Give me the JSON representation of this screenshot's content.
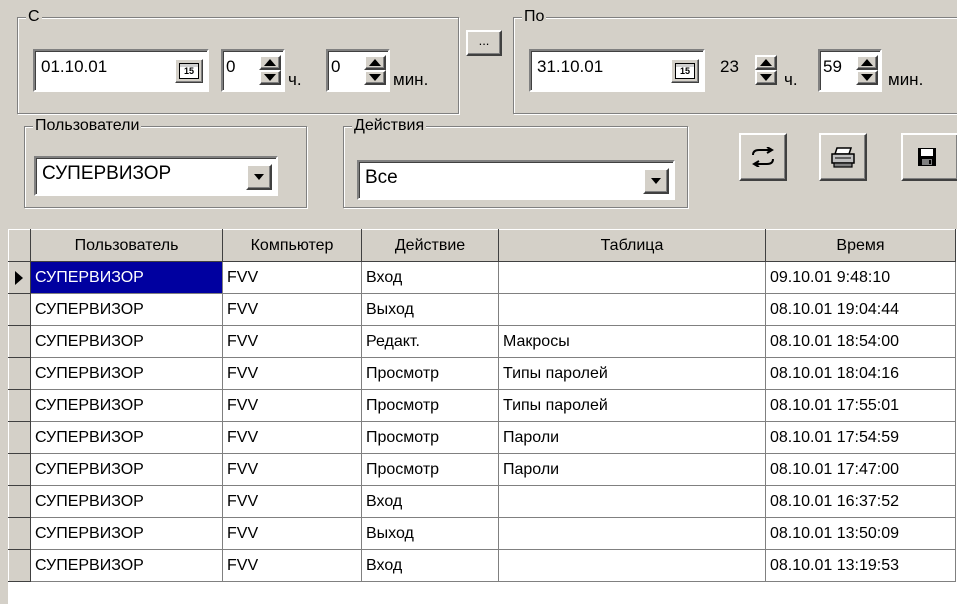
{
  "from": {
    "legend": "С",
    "date": "01.10.01",
    "calendar_icon_text": "15",
    "hours": "0",
    "hours_unit": "ч.",
    "minutes": "0",
    "minutes_unit": "мин."
  },
  "ellipsis_button_label": "...",
  "to": {
    "legend": "По",
    "date": "31.10.01",
    "calendar_icon_text": "15",
    "hours": "23",
    "hours_unit": "ч.",
    "minutes": "59",
    "minutes_unit": "мин."
  },
  "users": {
    "legend": "Пользователи",
    "selected": "СУПЕРВИЗОР"
  },
  "actions": {
    "legend": "Действия",
    "selected": "Все"
  },
  "toolbar_icons": [
    "refresh-icon",
    "printer-icon",
    "floppy-disk-icon"
  ],
  "table": {
    "columns": [
      "Пользователь",
      "Компьютер",
      "Действие",
      "Таблица",
      "Время"
    ],
    "rows": [
      [
        "СУПЕРВИЗОР",
        "FVV",
        "Вход",
        "",
        "09.10.01 9:48:10"
      ],
      [
        "СУПЕРВИЗОР",
        "FVV",
        "Выход",
        "",
        "08.10.01 19:04:44"
      ],
      [
        "СУПЕРВИЗОР",
        "FVV",
        "Редакт.",
        "Макросы",
        "08.10.01 18:54:00"
      ],
      [
        "СУПЕРВИЗОР",
        "FVV",
        "Просмотр",
        "Типы паролей",
        "08.10.01 18:04:16"
      ],
      [
        "СУПЕРВИЗОР",
        "FVV",
        "Просмотр",
        "Типы паролей",
        "08.10.01 17:55:01"
      ],
      [
        "СУПЕРВИЗОР",
        "FVV",
        "Просмотр",
        "Пароли",
        "08.10.01 17:54:59"
      ],
      [
        "СУПЕРВИЗОР",
        "FVV",
        "Просмотр",
        "Пароли",
        "08.10.01 17:47:00"
      ],
      [
        "СУПЕРВИЗОР",
        "FVV",
        "Вход",
        "",
        "08.10.01 16:37:52"
      ],
      [
        "СУПЕРВИЗОР",
        "FVV",
        "Выход",
        "",
        "08.10.01 13:50:09"
      ],
      [
        "СУПЕРВИЗОР",
        "FVV",
        "Вход",
        "",
        "08.10.01 13:19:53"
      ]
    ]
  },
  "colors": {
    "selection": "#0000a0",
    "face": "#d4d0c8"
  }
}
